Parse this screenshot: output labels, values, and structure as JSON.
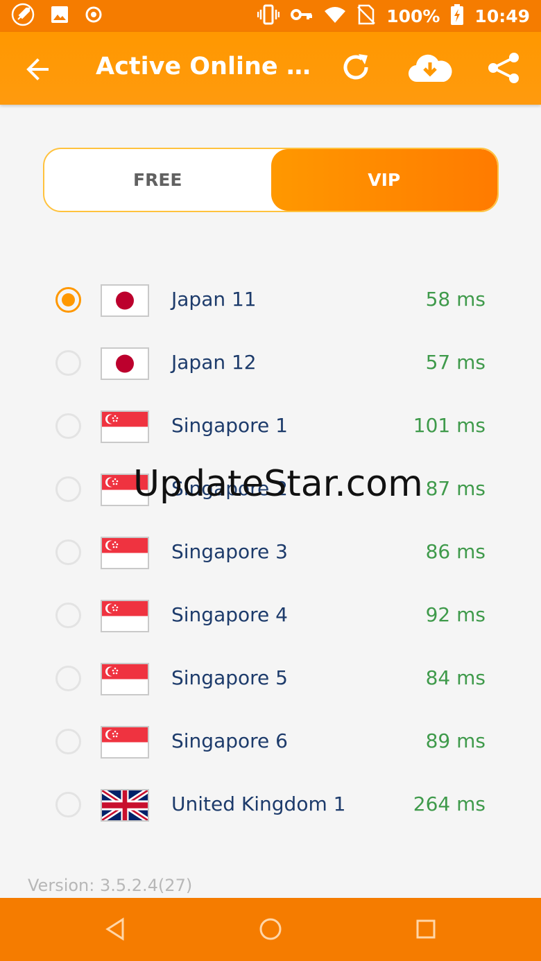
{
  "status_bar": {
    "battery": "100%",
    "time": "10:49"
  },
  "app_bar": {
    "title": "Active Online Se..."
  },
  "tabs": [
    {
      "label": "FREE",
      "active": false
    },
    {
      "label": "VIP",
      "active": true
    }
  ],
  "servers": [
    {
      "name": "Japan 11",
      "ping": "58 ms",
      "flag": "japan",
      "selected": true
    },
    {
      "name": "Japan 12",
      "ping": "57 ms",
      "flag": "japan",
      "selected": false
    },
    {
      "name": "Singapore 1",
      "ping": "101 ms",
      "flag": "singapore",
      "selected": false
    },
    {
      "name": "Singapore 2",
      "ping": "87 ms",
      "flag": "singapore",
      "selected": false
    },
    {
      "name": "Singapore 3",
      "ping": "86 ms",
      "flag": "singapore",
      "selected": false
    },
    {
      "name": "Singapore 4",
      "ping": "92 ms",
      "flag": "singapore",
      "selected": false
    },
    {
      "name": "Singapore 5",
      "ping": "84 ms",
      "flag": "singapore",
      "selected": false
    },
    {
      "name": "Singapore 6",
      "ping": "89 ms",
      "flag": "singapore",
      "selected": false
    },
    {
      "name": "United Kingdom 1",
      "ping": "264 ms",
      "flag": "united-kingdom",
      "selected": false
    }
  ],
  "watermark": "UpdateStar.com",
  "version": "Version: 3.5.2.4(27)",
  "colors": {
    "accent": "#ff9800",
    "status_bar": "#f57c00",
    "ping": "#3f9a4b",
    "server_name": "#1d3b6b"
  }
}
